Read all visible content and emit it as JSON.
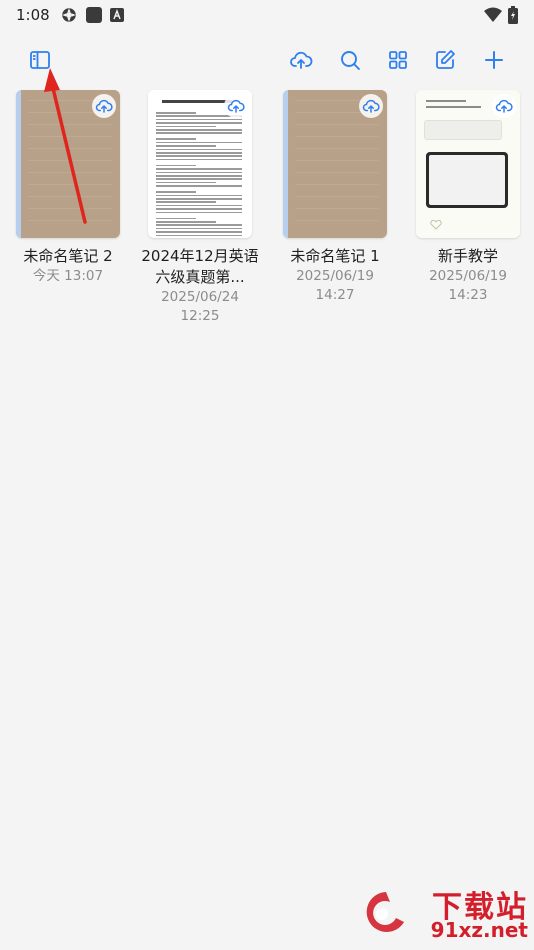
{
  "status_bar": {
    "time": "1:08",
    "icons_left": [
      "settings-gear-icon",
      "app-square-icon",
      "text-a-icon"
    ],
    "icons_right": [
      "wifi-icon",
      "battery-icon"
    ]
  },
  "toolbar": {
    "left": [
      {
        "name": "sidebar-toggle",
        "icon": "sidebar-icon"
      }
    ],
    "right": [
      {
        "name": "cloud-sync",
        "icon": "cloud-upload-icon"
      },
      {
        "name": "search",
        "icon": "search-icon"
      },
      {
        "name": "grid-view",
        "icon": "grid-icon"
      },
      {
        "name": "edit",
        "icon": "edit-icon"
      },
      {
        "name": "add",
        "icon": "plus-icon"
      }
    ],
    "accent_color": "#2f7ff0"
  },
  "notes": [
    {
      "title": "未命名笔记 2",
      "date": "今天 13:07",
      "time": "",
      "cover": "kraft"
    },
    {
      "title": "2024年12月英语六级真题第...",
      "date": "2025/06/24",
      "time": "12:25",
      "cover": "document"
    },
    {
      "title": "未命名笔记 1",
      "date": "2025/06/19",
      "time": "14:27",
      "cover": "kraft"
    },
    {
      "title": "新手教学",
      "date": "2025/06/19",
      "time": "14:23",
      "cover": "guide"
    }
  ],
  "watermark": {
    "line1": "下载站",
    "line2": "91xz.net",
    "color": "#d31f2b"
  }
}
